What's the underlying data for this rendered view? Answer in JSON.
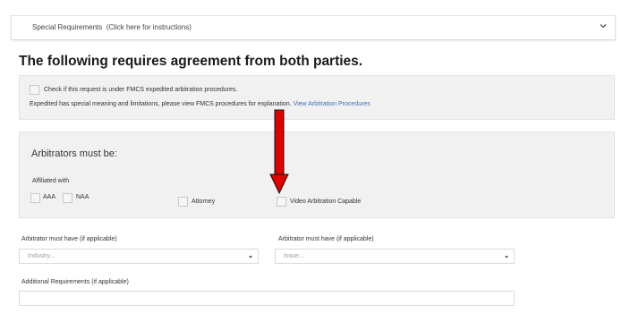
{
  "section": {
    "title": "Special Requirements",
    "instructions_link": "(Click here for instructions)",
    "collapse_icon": "chevron-down-icon"
  },
  "heading": "The following requires agreement from both parties.",
  "expedited": {
    "checkbox_label": "Check if this request is under FMCS expedited arbitration procedures.",
    "checked": false,
    "note": "Expedited has special meaning and limitations, please view FMCS procedures for explanation.",
    "link_label": "View Arbitration Procedures"
  },
  "arbitrators": {
    "title": "Arbitrators must be:",
    "affiliated_label": "Affiliated with",
    "options": {
      "aaa": "AAA",
      "naa": "NAA",
      "attorney": "Attorney",
      "video": "Video Arbitration Capable"
    }
  },
  "fields": {
    "industry_label": "Arbitrator must have (if applicable)",
    "industry_placeholder": "Industry...",
    "issue_label": "Arbitrator must have (if applicable)",
    "issue_placeholder": "Issue...",
    "additional_label": "Additional Requirements (if applicable)",
    "additional_value": ""
  },
  "annotation": {
    "arrow_color": "#e00000",
    "arrow_icon": "red-down-arrow-icon"
  },
  "colors": {
    "link": "#3b73b9",
    "panel_bg": "#f1f1f1"
  }
}
